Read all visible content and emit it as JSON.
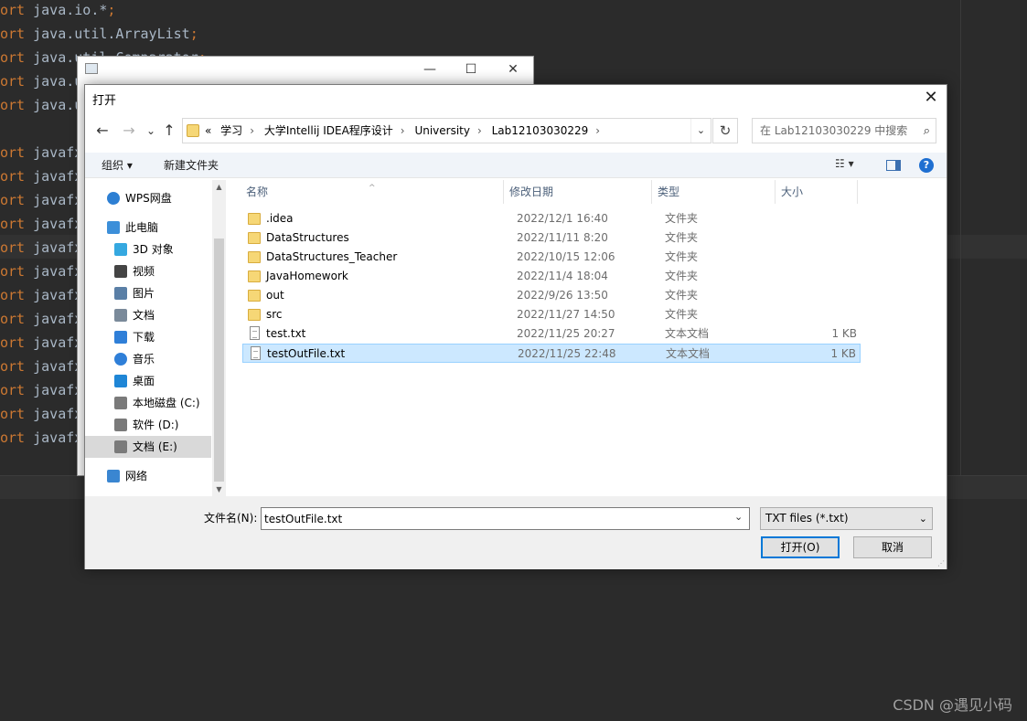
{
  "editor": {
    "lines": [
      {
        "kw": "ort",
        "text": " java.io.*",
        "semi": ";"
      },
      {
        "kw": "ort",
        "text": " java.util.ArrayList",
        "semi": ";"
      },
      {
        "kw": "ort",
        "text": " java.util.Comparator",
        "semi": ";"
      },
      {
        "kw": "ort",
        "text": " java.u",
        "semi": ""
      },
      {
        "kw": "ort",
        "text": " java.u",
        "semi": ""
      },
      {
        "kw": "",
        "text": "",
        "semi": ""
      },
      {
        "kw": "ort",
        "text": " javafx",
        "semi": ""
      },
      {
        "kw": "ort",
        "text": " javafx",
        "semi": ""
      },
      {
        "kw": "ort",
        "text": " javafx",
        "semi": ""
      },
      {
        "kw": "ort",
        "text": " javafx",
        "semi": ""
      },
      {
        "kw": "ort",
        "text": " javafx",
        "semi": ""
      },
      {
        "kw": "ort",
        "text": " javafx",
        "semi": ""
      },
      {
        "kw": "ort",
        "text": " javafx",
        "semi": ""
      },
      {
        "kw": "ort",
        "text": " javafx",
        "semi": ""
      },
      {
        "kw": "ort",
        "text": " javafx",
        "semi": ""
      },
      {
        "kw": "ort",
        "text": " javafx",
        "semi": ""
      },
      {
        "kw": "ort",
        "text": " javafx",
        "semi": ""
      },
      {
        "kw": "ort",
        "text": " javafx",
        "semi": ""
      },
      {
        "kw": "ort",
        "text": " javafx",
        "semi": ""
      }
    ],
    "watermark": "CSDN @遇见小码"
  },
  "bg_window": {
    "minimize": "—",
    "maximize": "☐",
    "close": "✕"
  },
  "dialog": {
    "title": "打开",
    "close": "✕",
    "nav": {
      "back": "←",
      "forward": "→",
      "recent": "⌄",
      "up": "↑"
    },
    "address": {
      "overflow": "«",
      "crumbs": [
        "学习",
        "大学Intellij IDEA程序设计",
        "University",
        "Lab12103030229"
      ],
      "sep": "›",
      "dropdown": "⌄"
    },
    "refresh": "↻",
    "search_placeholder": "在 Lab12103030229 中搜索",
    "search_icon": "⌕",
    "toolbar": {
      "organize": "组织 ▾",
      "new_folder": "新建文件夹",
      "view": "☷ ▾",
      "help": "?"
    },
    "nav_pane": [
      {
        "label": "WPS网盘",
        "icon": "cloud-icon",
        "color": "#2d7fd3",
        "indent": 0
      },
      {
        "label": "此电脑",
        "icon": "computer-icon",
        "color": "#3c8fd9",
        "indent": 0
      },
      {
        "label": "3D 对象",
        "icon": "cube-icon",
        "color": "#35a8e0",
        "indent": 1
      },
      {
        "label": "视频",
        "icon": "film-icon",
        "color": "#444444",
        "indent": 1
      },
      {
        "label": "图片",
        "icon": "picture-icon",
        "color": "#5a7fa6",
        "indent": 1
      },
      {
        "label": "文档",
        "icon": "document-icon",
        "color": "#7a8a9a",
        "indent": 1
      },
      {
        "label": "下载",
        "icon": "download-icon",
        "color": "#2f7fd8",
        "indent": 1
      },
      {
        "label": "音乐",
        "icon": "music-icon",
        "color": "#2f7fd8",
        "indent": 1
      },
      {
        "label": "桌面",
        "icon": "desktop-icon",
        "color": "#1f86d6",
        "indent": 1
      },
      {
        "label": "本地磁盘 (C:)",
        "icon": "drive-c-icon",
        "color": "#7a7a7a",
        "indent": 1
      },
      {
        "label": "软件 (D:)",
        "icon": "drive-icon",
        "color": "#7a7a7a",
        "indent": 1
      },
      {
        "label": "文档 (E:)",
        "icon": "drive-icon",
        "color": "#7a7a7a",
        "indent": 1,
        "selected": true
      },
      {
        "label": "网络",
        "icon": "network-icon",
        "color": "#3a86d1",
        "indent": 0
      }
    ],
    "columns": {
      "name": "名称",
      "modified": "修改日期",
      "type": "类型",
      "size": "大小",
      "sort_indicator": "^"
    },
    "files": [
      {
        "name": ".idea",
        "modified": "2022/12/1 16:40",
        "type": "文件夹",
        "size": "",
        "kind": "folder"
      },
      {
        "name": "DataStructures",
        "modified": "2022/11/11 8:20",
        "type": "文件夹",
        "size": "",
        "kind": "folder"
      },
      {
        "name": "DataStructures_Teacher",
        "modified": "2022/10/15 12:06",
        "type": "文件夹",
        "size": "",
        "kind": "folder"
      },
      {
        "name": "JavaHomework",
        "modified": "2022/11/4 18:04",
        "type": "文件夹",
        "size": "",
        "kind": "folder"
      },
      {
        "name": "out",
        "modified": "2022/9/26 13:50",
        "type": "文件夹",
        "size": "",
        "kind": "folder"
      },
      {
        "name": "src",
        "modified": "2022/11/27 14:50",
        "type": "文件夹",
        "size": "",
        "kind": "folder"
      },
      {
        "name": "test.txt",
        "modified": "2022/11/25 20:27",
        "type": "文本文档",
        "size": "1 KB",
        "kind": "file"
      },
      {
        "name": "testOutFile.txt",
        "modified": "2022/11/25 22:48",
        "type": "文本文档",
        "size": "1 KB",
        "kind": "file",
        "selected": true
      }
    ],
    "filename_label": "文件名(N):",
    "filename_value": "testOutFile.txt",
    "filename_dropdown": "⌄",
    "filter_value": "TXT files (*.txt)",
    "filter_dropdown": "⌄",
    "open_button": "打开(O)",
    "cancel_button": "取消"
  }
}
